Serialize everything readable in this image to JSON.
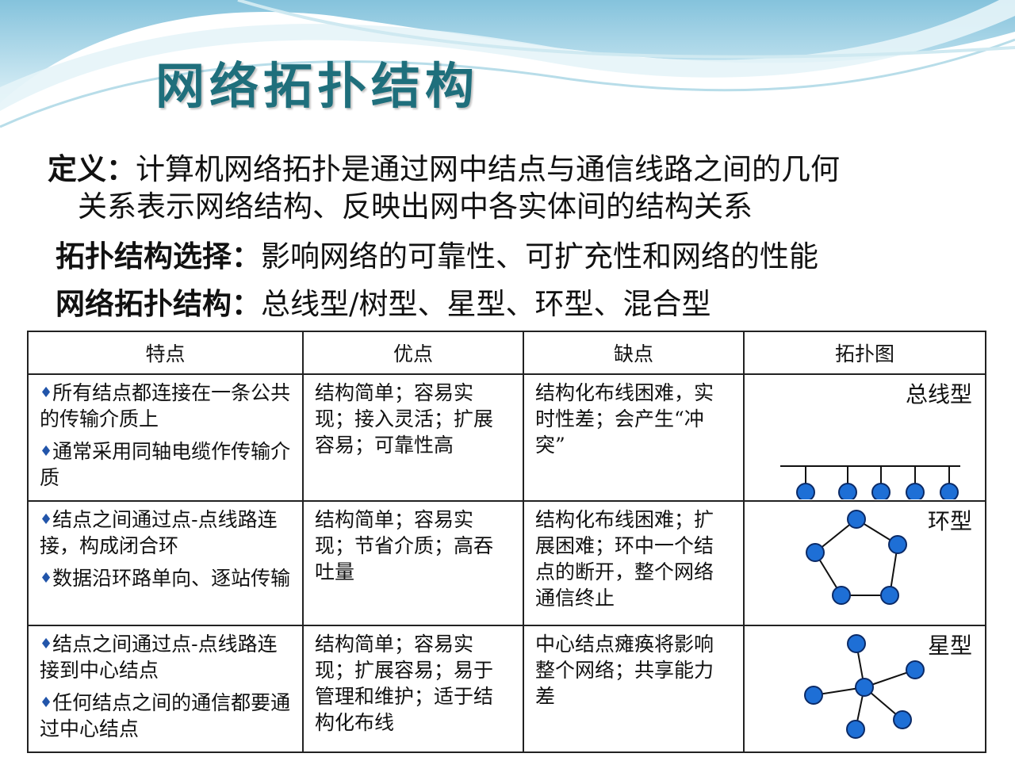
{
  "title": "网络拓扑结构",
  "definition": {
    "label": "定义：",
    "text_line1": "计算机网络拓扑是通过网中结点与通信线路之间的几何",
    "text_line2": "关系表示网络结构、反映出网中各实体间的结构关系"
  },
  "selection": {
    "label": "拓扑结构选择：",
    "text": "影响网络的可靠性、可扩充性和网络的性能"
  },
  "types": {
    "label": "网络拓扑结构：",
    "text": "总线型/树型、星型、环型、混合型"
  },
  "table": {
    "headers": [
      "特点",
      "优点",
      "缺点",
      "拓扑图"
    ],
    "rows": [
      {
        "features": [
          "所有结点都连接在一条公共的传输介质上",
          "通常采用同轴电缆作传输介质"
        ],
        "pros": "结构简单；容易实现；接入灵活；扩展容易；可靠性高",
        "cons": "结构化布线困难，实时性差；会产生“冲突”",
        "diagram_label": "总线型"
      },
      {
        "features": [
          "结点之间通过点-点线路连接，构成闭合环",
          "数据沿环路单向、逐站传输"
        ],
        "pros": "结构简单；容易实现；节省介质；高吞吐量",
        "cons": "结构化布线困难；扩展困难；环中一个结点的断开，整个网络通信终止",
        "diagram_label": "环型"
      },
      {
        "features": [
          "结点之间通过点-点线路连接到中心结点",
          "任何结点之间的通信都要通过中心结点"
        ],
        "pros": "结构简单；容易实现；扩展容易；易于管理和维护；适于结构化布线",
        "cons": "中心结点瘫痪将影响整个网络；共享能力差",
        "diagram_label": "星型"
      }
    ]
  },
  "colors": {
    "title": "#1f6f7c",
    "node_fill": "#1e6fd6",
    "node_stroke": "#0b2a66",
    "bullet": "#2255aa"
  },
  "icons": {
    "bullet": "diamond"
  }
}
